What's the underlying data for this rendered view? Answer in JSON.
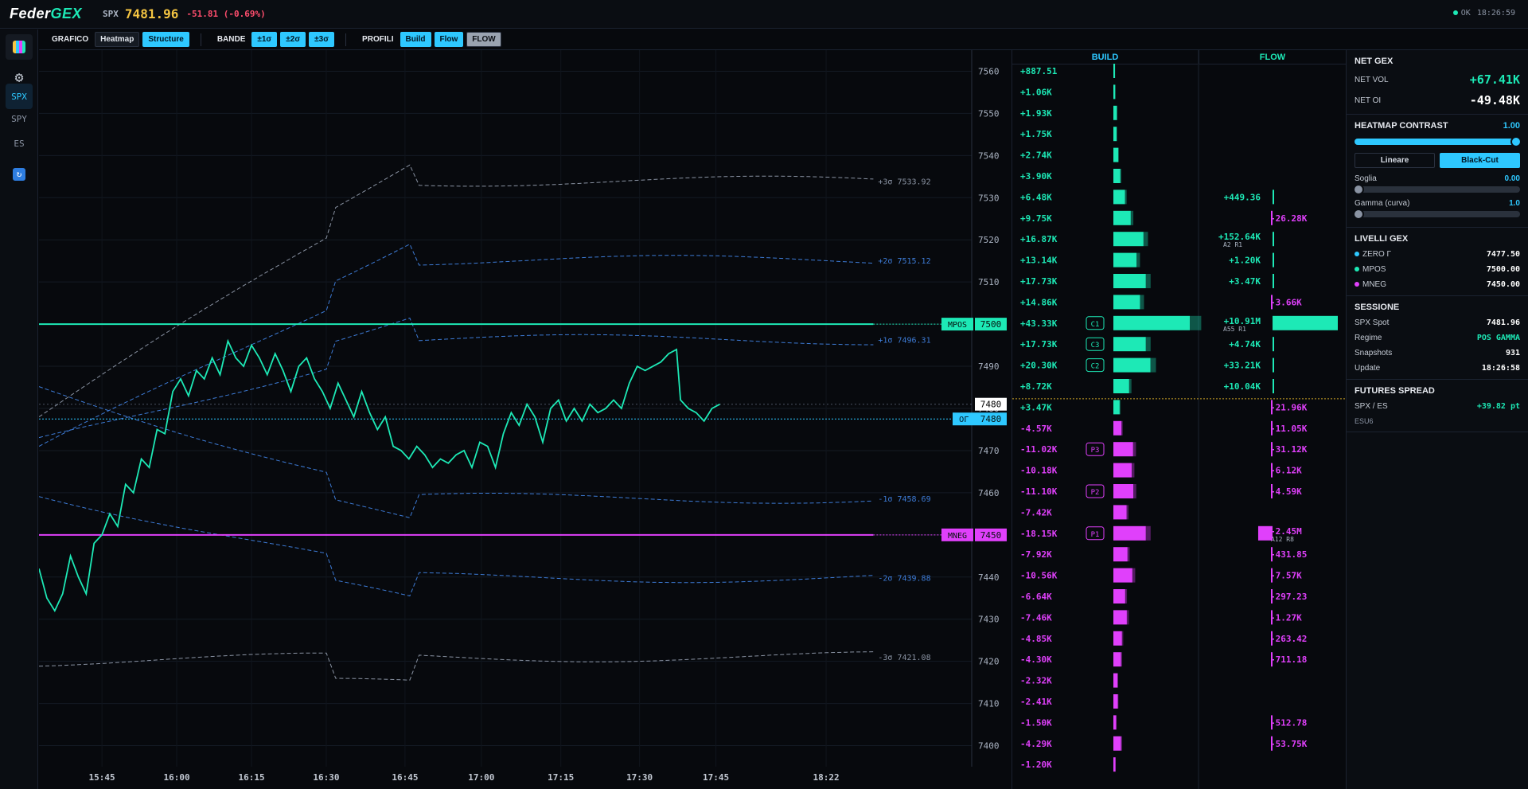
{
  "topbar": {
    "logo_a": "Feder",
    "logo_b": "GEX",
    "ticker": "SPX",
    "price": "7481.96",
    "change": "-51.81 (-0.69%)",
    "status": "OK",
    "clock": "18:26:59"
  },
  "sidebar": {
    "tickers": [
      "SPX",
      "SPY",
      "ES"
    ]
  },
  "toolbar": {
    "grafico": "GRAFICO",
    "heatmap": "Heatmap",
    "structure": "Structure",
    "bande": "BANDE",
    "s1": "±1σ",
    "s2": "±2σ",
    "s3": "±3σ",
    "profili": "PROFILI",
    "build": "Build",
    "flow": "Flow",
    "flow_caps": "FLOW"
  },
  "chart_data": {
    "type": "line",
    "title": "",
    "ylim": [
      7395,
      7565
    ],
    "xlim": [
      0,
      1185
    ],
    "x_ticks": [
      {
        "t": 80,
        "label": "15:45"
      },
      {
        "t": 175,
        "label": "16:00"
      },
      {
        "t": 270,
        "label": "16:15"
      },
      {
        "t": 365,
        "label": "16:30"
      },
      {
        "t": 465,
        "label": "16:45"
      },
      {
        "t": 562,
        "label": "17:00"
      },
      {
        "t": 663,
        "label": "17:15"
      },
      {
        "t": 763,
        "label": "17:30"
      },
      {
        "t": 860,
        "label": "17:45"
      },
      {
        "t": 1000,
        "label": "18:22"
      }
    ],
    "y_ticks": [
      7560,
      7550,
      7540,
      7530,
      7520,
      7510,
      7500,
      7490,
      7480,
      7470,
      7460,
      7450,
      7440,
      7430,
      7420,
      7410,
      7400
    ],
    "levels": [
      {
        "name": "MPOS",
        "value": 7500,
        "color": "#1de9b6",
        "label": "MPOS",
        "price": "7500"
      },
      {
        "name": "MNEG",
        "value": 7450,
        "color": "#e040fb",
        "label": "MNEG",
        "price": "7450"
      },
      {
        "name": "ZERO",
        "value": 7477.5,
        "color": "#2ec8ff",
        "label": "0Γ",
        "price": "7480"
      }
    ],
    "spot_label": "7480",
    "bands": [
      {
        "label": "+3σ 7533.92",
        "end": 7533.92,
        "color": "#8a93a3"
      },
      {
        "label": "+2σ 7515.12",
        "end": 7515.12,
        "color": "#3d7bd6"
      },
      {
        "label": "+1σ 7496.31",
        "end": 7496.31,
        "color": "#3d7bd6"
      },
      {
        "label": "-1σ 7458.69",
        "end": 7458.69,
        "color": "#3d7bd6"
      },
      {
        "label": "-2σ 7439.88",
        "end": 7439.88,
        "color": "#3d7bd6"
      },
      {
        "label": "-3σ 7421.08",
        "end": 7421.08,
        "color": "#8a93a3"
      }
    ],
    "series": [
      {
        "values": [
          [
            0,
            7442
          ],
          [
            10,
            7435
          ],
          [
            20,
            7432
          ],
          [
            30,
            7436
          ],
          [
            40,
            7445
          ],
          [
            50,
            7440
          ],
          [
            60,
            7436
          ],
          [
            70,
            7448
          ],
          [
            80,
            7450
          ],
          [
            90,
            7455
          ],
          [
            100,
            7452
          ],
          [
            110,
            7462
          ],
          [
            120,
            7460
          ],
          [
            130,
            7468
          ],
          [
            140,
            7466
          ],
          [
            150,
            7475
          ],
          [
            160,
            7474
          ],
          [
            170,
            7484
          ],
          [
            180,
            7487
          ],
          [
            190,
            7483
          ],
          [
            200,
            7489
          ],
          [
            210,
            7487
          ],
          [
            220,
            7492
          ],
          [
            230,
            7488
          ],
          [
            240,
            7496
          ],
          [
            250,
            7492
          ],
          [
            260,
            7490
          ],
          [
            270,
            7495
          ],
          [
            280,
            7492
          ],
          [
            290,
            7488
          ],
          [
            300,
            7493
          ],
          [
            310,
            7489
          ],
          [
            320,
            7484
          ],
          [
            330,
            7490
          ],
          [
            340,
            7492
          ],
          [
            350,
            7487
          ],
          [
            360,
            7484
          ],
          [
            370,
            7480
          ],
          [
            380,
            7486
          ],
          [
            390,
            7482
          ],
          [
            400,
            7478
          ],
          [
            410,
            7484
          ],
          [
            420,
            7479
          ],
          [
            430,
            7475
          ],
          [
            440,
            7478
          ],
          [
            450,
            7471
          ],
          [
            460,
            7470
          ],
          [
            470,
            7468
          ],
          [
            480,
            7471
          ],
          [
            490,
            7469
          ],
          [
            500,
            7466
          ],
          [
            510,
            7468
          ],
          [
            520,
            7467
          ],
          [
            530,
            7469
          ],
          [
            540,
            7470
          ],
          [
            550,
            7466
          ],
          [
            560,
            7472
          ],
          [
            570,
            7471
          ],
          [
            580,
            7466
          ],
          [
            590,
            7474
          ],
          [
            600,
            7479
          ],
          [
            610,
            7476
          ],
          [
            620,
            7481
          ],
          [
            630,
            7478
          ],
          [
            640,
            7472
          ],
          [
            650,
            7480
          ],
          [
            660,
            7482
          ],
          [
            670,
            7477
          ],
          [
            680,
            7480
          ],
          [
            690,
            7477
          ],
          [
            700,
            7481
          ],
          [
            710,
            7479
          ],
          [
            720,
            7480
          ],
          [
            730,
            7482
          ],
          [
            740,
            7480
          ],
          [
            750,
            7486
          ],
          [
            760,
            7490
          ],
          [
            770,
            7489
          ],
          [
            780,
            7490
          ],
          [
            790,
            7491
          ],
          [
            800,
            7493
          ],
          [
            810,
            7494
          ],
          [
            815,
            7482
          ],
          [
            825,
            7480
          ],
          [
            835,
            7479
          ],
          [
            845,
            7477
          ],
          [
            855,
            7480
          ],
          [
            865,
            7481
          ]
        ]
      }
    ]
  },
  "build_header": "BUILD",
  "flow_header": "FLOW",
  "build_rows": [
    {
      "label": "+887.51",
      "pct": 0.5,
      "color": "#1de9b6"
    },
    {
      "label": "+1.06K",
      "pct": 0.8,
      "color": "#1de9b6"
    },
    {
      "label": "+1.93K",
      "pct": 1.5,
      "color": "#1de9b6"
    },
    {
      "label": "+1.75K",
      "pct": 1.4,
      "color": "#1de9b6"
    },
    {
      "label": "+2.74K",
      "pct": 2.1,
      "color": "#1de9b6"
    },
    {
      "label": "+3.90K",
      "pct": 3,
      "color": "#1de9b6"
    },
    {
      "label": "+6.48K",
      "pct": 5,
      "color": "#1de9b6"
    },
    {
      "label": "+9.75K",
      "pct": 7.5,
      "color": "#1de9b6"
    },
    {
      "label": "+16.87K",
      "pct": 13,
      "color": "#1de9b6"
    },
    {
      "label": "+13.14K",
      "pct": 10,
      "color": "#1de9b6"
    },
    {
      "label": "+17.73K",
      "pct": 14,
      "color": "#1de9b6"
    },
    {
      "label": "+14.86K",
      "pct": 11.5,
      "color": "#1de9b6"
    },
    {
      "label": "+43.33K",
      "pct": 33,
      "color": "#1de9b6",
      "tag": "C1"
    },
    {
      "label": "+17.73K",
      "pct": 14,
      "color": "#1de9b6",
      "tag": "C3"
    },
    {
      "label": "+20.30K",
      "pct": 16,
      "color": "#1de9b6",
      "tag": "C2"
    },
    {
      "label": "+8.72K",
      "pct": 6.8,
      "color": "#1de9b6"
    },
    {
      "label": "+3.47K",
      "pct": 2.7,
      "color": "#1de9b6"
    },
    {
      "label": "-4.57K",
      "pct": 3.5,
      "color": "#e040fb"
    },
    {
      "label": "-11.02K",
      "pct": 8.5,
      "color": "#e040fb",
      "tag": "P3"
    },
    {
      "label": "-10.18K",
      "pct": 7.9,
      "color": "#e040fb"
    },
    {
      "label": "-11.10K",
      "pct": 8.6,
      "color": "#e040fb",
      "tag": "P2"
    },
    {
      "label": "-7.42K",
      "pct": 5.7,
      "color": "#e040fb"
    },
    {
      "label": "-18.15K",
      "pct": 14,
      "color": "#e040fb",
      "tag": "P1"
    },
    {
      "label": "-7.92K",
      "pct": 6.1,
      "color": "#e040fb"
    },
    {
      "label": "-10.56K",
      "pct": 8.2,
      "color": "#e040fb"
    },
    {
      "label": "-6.64K",
      "pct": 5.1,
      "color": "#e040fb"
    },
    {
      "label": "-7.46K",
      "pct": 5.8,
      "color": "#e040fb"
    },
    {
      "label": "-4.85K",
      "pct": 3.7,
      "color": "#e040fb"
    },
    {
      "label": "-4.30K",
      "pct": 3.3,
      "color": "#e040fb"
    },
    {
      "label": "-2.32K",
      "pct": 1.8,
      "color": "#e040fb"
    },
    {
      "label": "-2.41K",
      "pct": 1.9,
      "color": "#e040fb"
    },
    {
      "label": "-1.50K",
      "pct": 1.2,
      "color": "#e040fb"
    },
    {
      "label": "-4.29K",
      "pct": 3.3,
      "color": "#e040fb"
    },
    {
      "label": "-1.20K",
      "pct": 0.9,
      "color": "#e040fb"
    }
  ],
  "flow_rows": [
    {},
    {},
    {},
    {},
    {},
    {},
    {
      "label": "+449.36",
      "side": "pos",
      "pct": 1
    },
    {
      "label": "-26.28K",
      "side": "neg",
      "pct": 1
    },
    {
      "label": "+152.64K",
      "sub": "A2  R1",
      "side": "pos",
      "pct": 1.5
    },
    {
      "label": "+1.20K",
      "side": "pos",
      "pct": 1
    },
    {
      "label": "+3.47K",
      "side": "pos",
      "pct": 1
    },
    {
      "label": "-3.66K",
      "side": "neg",
      "pct": 1
    },
    {
      "label": "+10.91M",
      "sub": "A55  R1",
      "side": "pos",
      "pct": 100
    },
    {
      "label": "+4.74K",
      "side": "pos",
      "pct": 1
    },
    {
      "label": "+33.21K",
      "side": "pos",
      "pct": 1
    },
    {
      "label": "+10.04K",
      "side": "pos",
      "pct": 1
    },
    {
      "label": "-21.96K",
      "side": "neg",
      "pct": 1
    },
    {
      "label": "-11.05K",
      "side": "neg",
      "pct": 1
    },
    {
      "label": "-31.12K",
      "side": "neg",
      "pct": 1
    },
    {
      "label": "-6.12K",
      "side": "neg",
      "pct": 1
    },
    {
      "label": "-4.59K",
      "side": "neg",
      "pct": 1
    },
    {},
    {
      "label": "-2.45M",
      "sub": "A12  R8",
      "side": "neg",
      "pct": 22
    },
    {
      "label": "-431.85",
      "side": "neg",
      "pct": 1
    },
    {
      "label": "-7.57K",
      "side": "neg",
      "pct": 1
    },
    {
      "label": "-297.23",
      "side": "neg",
      "pct": 1
    },
    {
      "label": "-1.27K",
      "side": "neg",
      "pct": 1
    },
    {
      "label": "-263.42",
      "side": "neg",
      "pct": 1
    },
    {
      "label": "-711.18",
      "side": "neg",
      "pct": 1
    },
    {},
    {},
    {
      "label": "-512.78",
      "side": "neg",
      "pct": 1
    },
    {
      "label": "-53.75K",
      "side": "neg",
      "pct": 1
    },
    {}
  ],
  "panel": {
    "net_title": "NET GEX",
    "net_vol_l": "NET VOL",
    "net_vol": "+67.41K",
    "net_oi_l": "NET OI",
    "net_oi": "-49.48K",
    "hc_title": "HEATMAP CONTRAST",
    "hc_val": "1.00",
    "lin": "Lineare",
    "bc": "Black-Cut",
    "soglia": "Soglia",
    "soglia_v": "0.00",
    "gamma": "Gamma (curva)",
    "gamma_v": "1.0",
    "lv_title": "LIVELLI GEX",
    "zero_l": "ZERO Γ",
    "zero_v": "7477.50",
    "mpos_l": "MPOS",
    "mpos_v": "7500.00",
    "mneg_l": "MNEG",
    "mneg_v": "7450.00",
    "sess_title": "SESSIONE",
    "spot_l": "SPX Spot",
    "spot_v": "7481.96",
    "reg_l": "Regime",
    "reg_v": "POS GAMMA",
    "snap_l": "Snapshots",
    "snap_v": "931",
    "upd_l": "Update",
    "upd_v": "18:26:58",
    "fut_title": "FUTURES SPREAD",
    "spr_l": "SPX / ES",
    "spr_v": "+39.82 pt",
    "esu": "ESU6"
  }
}
